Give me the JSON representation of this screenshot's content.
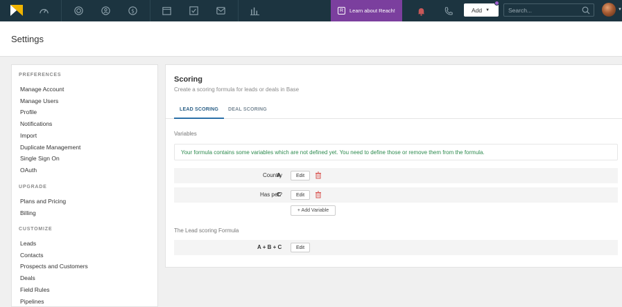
{
  "topbar": {
    "reach_label": "Learn about Reach!",
    "reach_badge": "R",
    "add_label": "Add",
    "search_placeholder": "Search...",
    "colors": {
      "bar": "#1c3440",
      "reach": "#7b3f9e",
      "logo": "#f0b400"
    }
  },
  "page": {
    "title": "Settings"
  },
  "sidebar": {
    "sections": [
      {
        "heading": "PREFERENCES",
        "items": [
          "Manage Account",
          "Manage Users",
          "Profile",
          "Notifications",
          "Import",
          "Duplicate Management",
          "Single Sign On",
          "OAuth"
        ]
      },
      {
        "heading": "UPGRADE",
        "items": [
          "Plans and Pricing",
          "Billing"
        ]
      },
      {
        "heading": "CUSTOMIZE",
        "items": [
          "Leads",
          "Contacts",
          "Prospects and Customers",
          "Deals",
          "Field Rules",
          "Pipelines"
        ]
      }
    ]
  },
  "main": {
    "title": "Scoring",
    "subtitle": "Create a scoring formula for leads or deals in Base",
    "tabs": [
      {
        "label": "LEAD SCORING",
        "active": true
      },
      {
        "label": "DEAL SCORING",
        "active": false
      }
    ],
    "variables_label": "Variables",
    "alert_text": "Your formula contains some variables which are not defined yet. You need to define those or remove them from the formula.",
    "variables": [
      {
        "name": "Country",
        "letter": "A",
        "edit_label": "Edit"
      },
      {
        "name": "Has pet?",
        "letter": "C",
        "edit_label": "Edit"
      }
    ],
    "add_variable_label": "+ Add Variable",
    "formula_label": "The Lead scoring Formula",
    "formula": "A + B + C",
    "formula_edit_label": "Edit"
  }
}
